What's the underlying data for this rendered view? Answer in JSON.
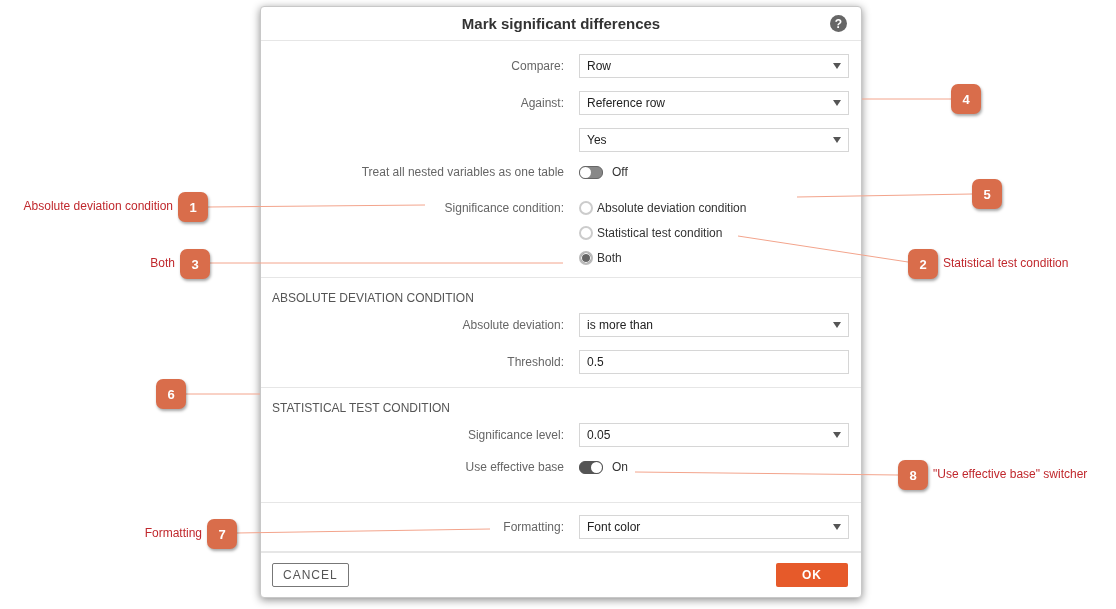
{
  "dialog": {
    "title": "Mark significant differences",
    "help_icon": "?",
    "sections": [
      {
        "rows": [
          {
            "kind": "select",
            "label": "Compare:",
            "value": "Row"
          },
          {
            "kind": "select",
            "label": "Against:",
            "value": "Reference row"
          },
          {
            "kind": "select",
            "value": "Yes"
          },
          {
            "kind": "toggle",
            "label": "Treat all nested variables as one table",
            "on": false,
            "state_text": "Off"
          },
          {
            "kind": "radio",
            "label": "Significance condition:",
            "options": [
              {
                "label": "Absolute deviation condition",
                "selected": false
              },
              {
                "label": "Statistical test condition",
                "selected": false
              },
              {
                "label": "Both",
                "selected": true
              }
            ]
          }
        ]
      },
      {
        "heading": "ABSOLUTE DEVIATION CONDITION",
        "rows": [
          {
            "kind": "select",
            "label": "Absolute deviation:",
            "value": "is more than"
          },
          {
            "kind": "input",
            "label": "Threshold:",
            "value": "0.5"
          }
        ]
      },
      {
        "heading": "STATISTICAL TEST CONDITION",
        "rows": [
          {
            "kind": "select",
            "label": "Significance level:",
            "value": "0.05"
          },
          {
            "kind": "toggle",
            "label": "Use effective base",
            "on": true,
            "state_text": "On"
          }
        ]
      },
      {
        "rows": [
          {
            "kind": "select",
            "label": "Formatting:",
            "value": "Font color"
          }
        ]
      }
    ],
    "buttons": {
      "cancel": "CANCEL",
      "ok": "OK"
    }
  },
  "callouts": [
    {
      "number": "4"
    },
    {
      "number": "5"
    },
    {
      "number": "1",
      "label": "Absolute deviation condition"
    },
    {
      "number": "3",
      "label": "Both"
    },
    {
      "number": "2",
      "label": "Statistical test condition"
    },
    {
      "number": "6"
    },
    {
      "number": "8",
      "label": "\"Use effective base\" switcher"
    },
    {
      "number": "7",
      "label": "Formatting"
    }
  ]
}
